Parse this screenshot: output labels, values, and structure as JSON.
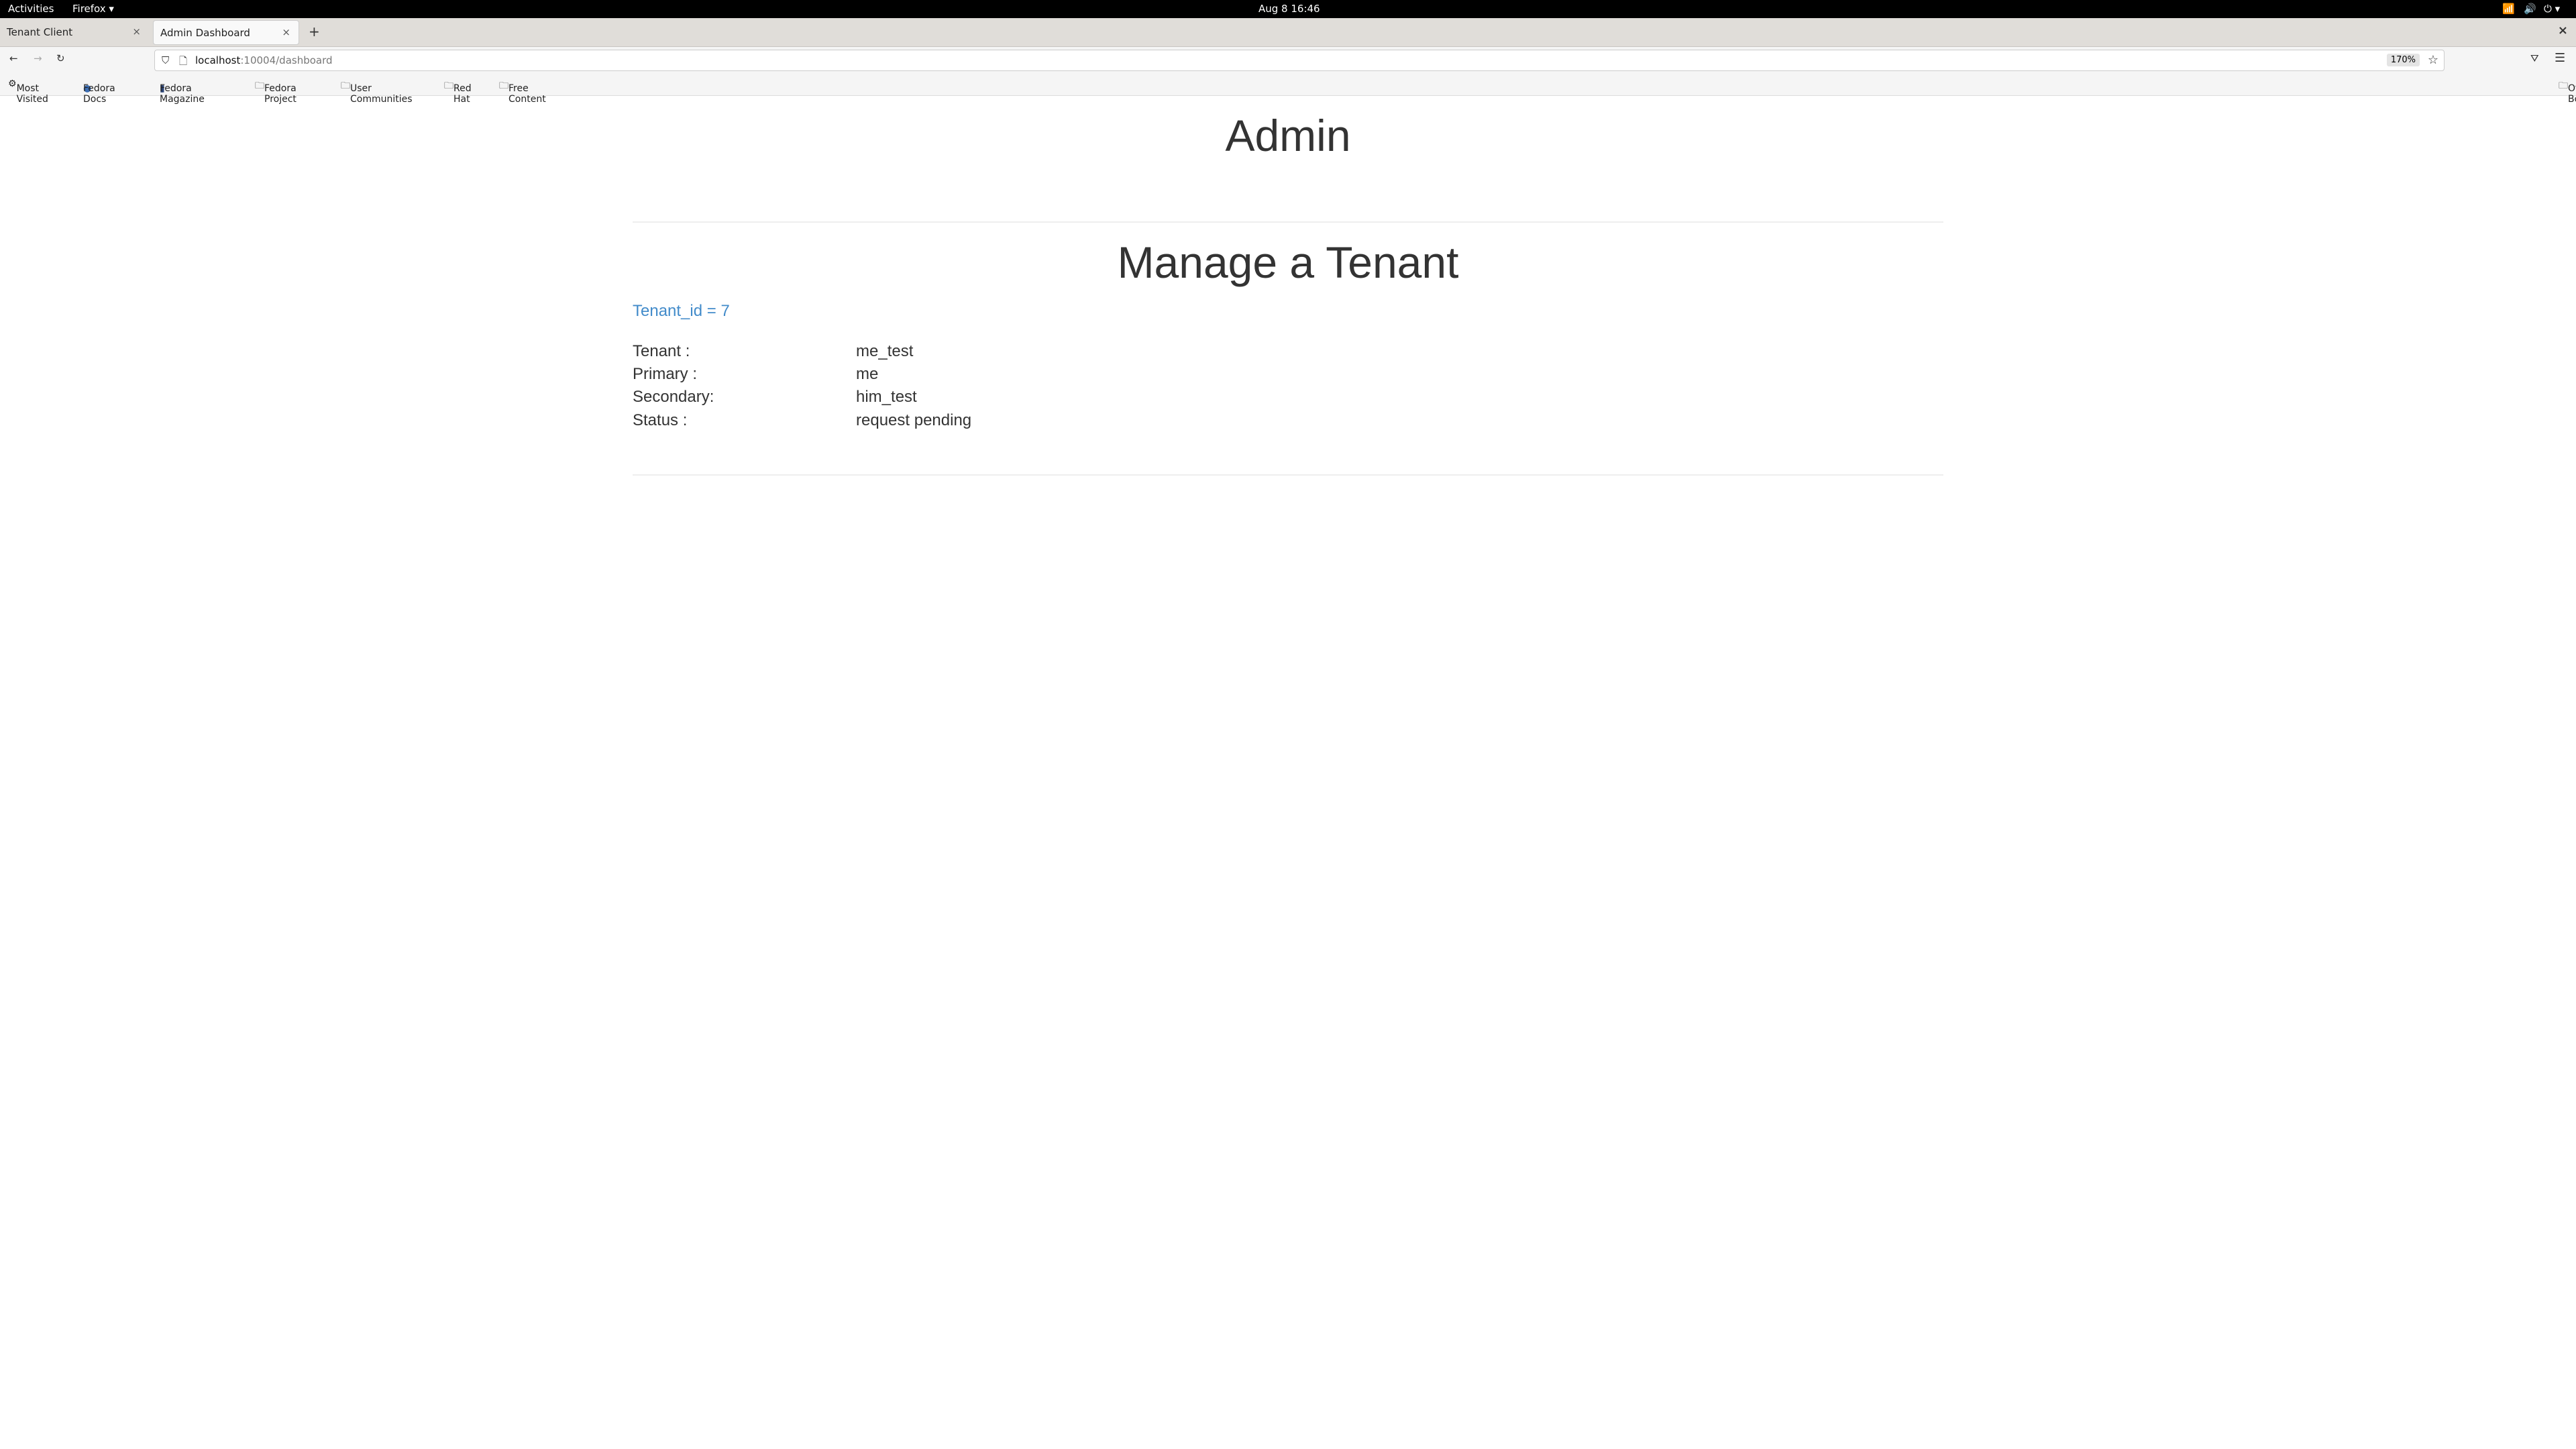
{
  "system": {
    "activities": "Activities",
    "app": "Firefox ▾",
    "clock": "Aug 8  16:46"
  },
  "tabs": [
    {
      "label": "Tenant Client"
    },
    {
      "label": "Admin Dashboard"
    }
  ],
  "url": {
    "host": "localhost",
    "path": ":10004/dashboard",
    "zoom": "170%"
  },
  "bookmarks": [
    "Most Visited",
    "Fedora Docs",
    "Fedora Magazine",
    "Fedora Project",
    "User Communities",
    "Red Hat",
    "Free Content"
  ],
  "other_bookmarks": "Other Bookmarks",
  "page": {
    "title": "Admin",
    "subtitle": "Manage a Tenant",
    "tenant_link": "Tenant_id = 7",
    "rows": [
      {
        "label": "Tenant :",
        "value": "me_test"
      },
      {
        "label": "Primary :",
        "value": "me"
      },
      {
        "label": "Secondary:",
        "value": "him_test"
      },
      {
        "label": "Status :",
        "value": "request pending"
      }
    ]
  }
}
